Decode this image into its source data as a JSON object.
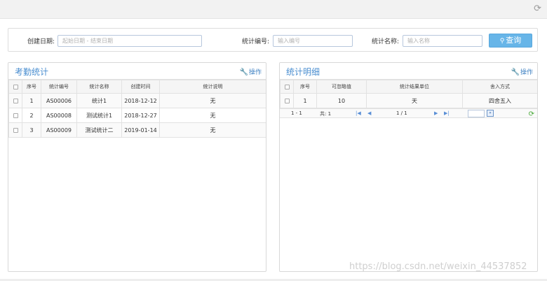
{
  "header": {
    "refresh_icon": "refresh-icon"
  },
  "search": {
    "date_label": "创建日期:",
    "date_placeholder": "起始日期 - 结束日期",
    "code_label": "统计编号:",
    "code_placeholder": "输入编号",
    "name_label": "统计名称:",
    "name_placeholder": "输入名称",
    "button_label": "查询",
    "button_icon": "search-icon",
    "button_color": "#67b5e8"
  },
  "left_panel": {
    "title": "考勤统计",
    "action_label": "操作",
    "action_icon": "wrench-icon",
    "columns": [
      "序号",
      "统计编号",
      "统计名称",
      "创建时间",
      "统计说明"
    ],
    "rows": [
      {
        "no": "1",
        "code": "AS00006",
        "name": "统计1",
        "created": "2018-12-12",
        "note": "无"
      },
      {
        "no": "2",
        "code": "AS00008",
        "name": "测试统计1",
        "created": "2018-12-27",
        "note": "无"
      },
      {
        "no": "3",
        "code": "AS00009",
        "name": "测试统计二",
        "created": "2019-01-14",
        "note": "无"
      }
    ]
  },
  "right_panel": {
    "title": "统计明细",
    "action_label": "操作",
    "action_icon": "wrench-icon",
    "columns": [
      "序号",
      "可忽略值",
      "统计结果单位",
      "舍入方式"
    ],
    "rows": [
      {
        "no": "1",
        "ignore": "10",
        "unit": "天",
        "rounding": "四舍五入"
      }
    ],
    "pager": {
      "range": "1 - 1",
      "total": "共: 1",
      "page": "1 / 1",
      "go_label": "»"
    }
  },
  "watermark": "https://blog.csdn.net/weixin_44537852",
  "title_color": "#4a8ed0"
}
